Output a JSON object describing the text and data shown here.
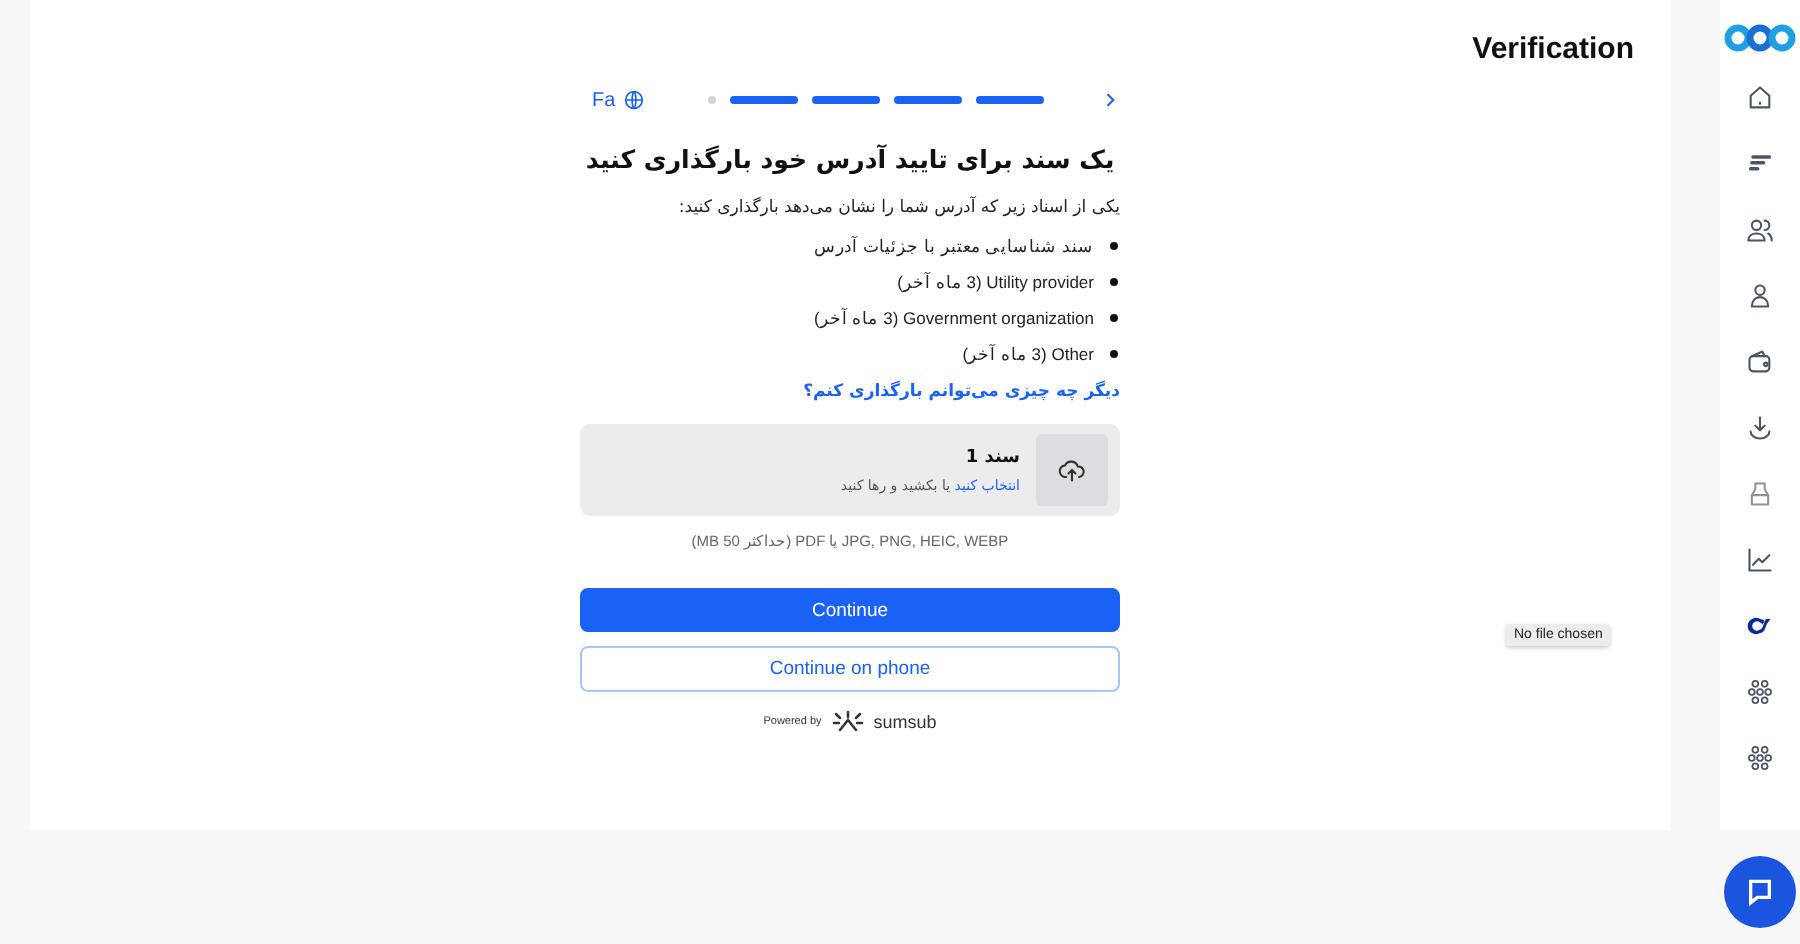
{
  "header": {
    "title": "Verification"
  },
  "language": {
    "label": "Fa"
  },
  "progress_steps": [
    {
      "done": false
    },
    {
      "done": true
    },
    {
      "done": true
    },
    {
      "done": true
    },
    {
      "done": true
    }
  ],
  "title": "یک سند برای تایید آدرس خود بارگذاری کنید",
  "subtitle": "یکی از اسناد زیر که آدرس شما را نشان می‌دهد بارگذاری کنید:",
  "documents": [
    "سند شناسایی معتبر با جزئیات آدرس",
    "Utility provider (3 ماه آخر)",
    "Government organization (3 ماه آخر)",
    "Other (3 ماه آخر)"
  ],
  "help_link": "دیگر چه چیزی می‌توانم بارگذاری کنم؟",
  "upload": {
    "title": "سند 1",
    "choose_link": "انتخاب کنید",
    "hint": " یا بکشید و رها کنید"
  },
  "formats": "JPG, PNG, HEIC, WEBP یا PDF (حداکثر 50 MB)",
  "buttons": [
    {
      "label": "Continue",
      "kind": "primary"
    },
    {
      "label": "Continue on phone",
      "kind": "secondary"
    }
  ],
  "powered_by": {
    "label": "Powered by",
    "brand": "sumsub"
  },
  "tooltip": "No file chosen"
}
